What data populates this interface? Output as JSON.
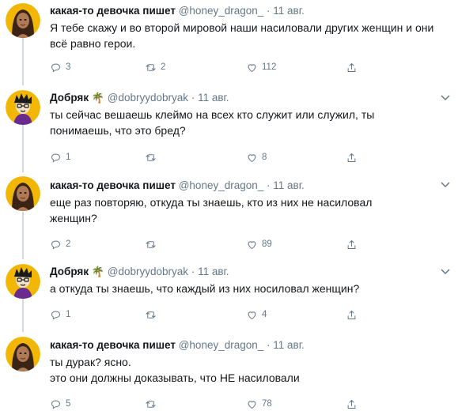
{
  "tweets": [
    {
      "author": "какая-то девочка пишет",
      "handle": "@honey_dragon_",
      "date": "· 11 авг.",
      "text": "Я тебе скажу и во второй мировой наши насиловали других женщин и они всё равно герои.",
      "replies": "3",
      "retweets": "2",
      "likes": "112",
      "avatar": "girl"
    },
    {
      "author": "Добряк",
      "badge": "palm-tree-icon",
      "handle": "@dobryydobryak",
      "date": "· 11 авг.",
      "text": "ты сейчас вешаешь клеймо на всех кто служит или служил, ты понимаешь, что это бред?",
      "replies": "1",
      "retweets": "",
      "likes": "8",
      "avatar": "boy"
    },
    {
      "author": "какая-то девочка пишет",
      "handle": "@honey_dragon_",
      "date": "· 11 авг.",
      "text": "еще раз повторяю, откуда ты знаешь, кто из них не насиловал женщин?",
      "replies": "2",
      "retweets": "",
      "likes": "89",
      "avatar": "girl"
    },
    {
      "author": "Добряк",
      "badge": "palm-tree-icon",
      "handle": "@dobryydobryak",
      "date": "· 11 авг.",
      "text": "а откуда ты знаешь, что каждый из них носиловал женщин?",
      "replies": "1",
      "retweets": "",
      "likes": "4",
      "avatar": "boy"
    },
    {
      "author": "какая-то девочка пишет",
      "handle": "@honey_dragon_",
      "date": "· 11 авг.",
      "text_lines": [
        "ты дурак? ясно.",
        "это они должны доказывать, что НЕ насиловали"
      ],
      "replies": "5",
      "retweets": "",
      "likes": "78",
      "avatar": "girl"
    }
  ],
  "colors": {
    "text": "#14171a",
    "muted": "#657786",
    "thread_line": "#cfd9de",
    "avatar_girl_bg": "#f2b705",
    "avatar_boy_bg": "#f2b705"
  }
}
